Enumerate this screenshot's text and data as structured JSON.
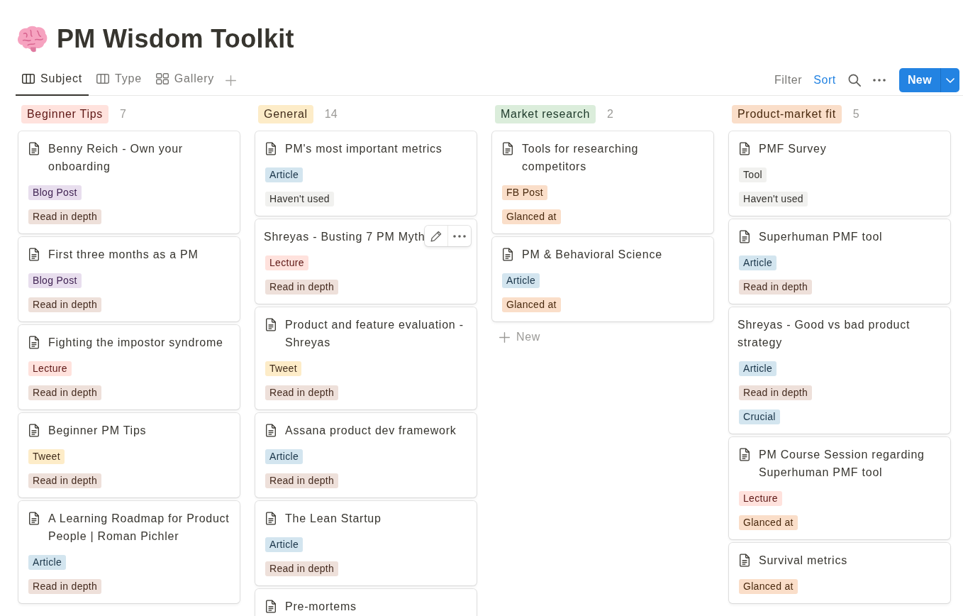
{
  "page": {
    "title": "PM Wisdom Toolkit"
  },
  "views": [
    {
      "label": "Subject",
      "kind": "board",
      "selected": true
    },
    {
      "label": "Type",
      "kind": "board",
      "selected": false
    },
    {
      "label": "Gallery",
      "kind": "gallery",
      "selected": false
    }
  ],
  "toolbar": {
    "actions": [
      {
        "label": "Filter",
        "active": false
      },
      {
        "label": "Sort",
        "active": true
      }
    ],
    "new_button": "New"
  },
  "columns": [
    {
      "title": "Beginner Tips",
      "color": "#ffe2dd",
      "count": "7",
      "cards": [
        {
          "title": "Benny Reich - Own your onboarding",
          "page_icon": true,
          "hovered": false,
          "tags": [
            {
              "label": "Blog Post",
              "color": "#e8deee"
            },
            {
              "label": "Read in depth",
              "color": "#eee0da"
            }
          ]
        },
        {
          "title": "First three months as a PM",
          "page_icon": true,
          "hovered": false,
          "tags": [
            {
              "label": "Blog Post",
              "color": "#e8deee"
            },
            {
              "label": "Read in depth",
              "color": "#eee0da"
            }
          ]
        },
        {
          "title": "Fighting the impostor syndrome",
          "page_icon": true,
          "hovered": false,
          "tags": [
            {
              "label": "Lecture",
              "color": "#ffe2dd"
            },
            {
              "label": "Read in depth",
              "color": "#eee0da"
            }
          ]
        },
        {
          "title": "Beginner PM Tips",
          "page_icon": true,
          "hovered": false,
          "tags": [
            {
              "label": "Tweet",
              "color": "#fdecc8"
            },
            {
              "label": "Read in depth",
              "color": "#eee0da"
            }
          ]
        },
        {
          "title": "A Learning Roadmap for Product People | Roman Pichler",
          "page_icon": true,
          "hovered": false,
          "tags": [
            {
              "label": "Article",
              "color": "#d3e5ef"
            },
            {
              "label": "Read in depth",
              "color": "#eee0da"
            }
          ]
        }
      ]
    },
    {
      "title": "General",
      "color": "#fdecc8",
      "count": "14",
      "cards": [
        {
          "title": "PM's most important metrics",
          "page_icon": true,
          "hovered": false,
          "tags": [
            {
              "label": "Article",
              "color": "#d3e5ef"
            },
            {
              "label": "Haven't used",
              "color": "#f1f1ef"
            }
          ]
        },
        {
          "title": "Shreyas - Busting 7 PM Myth",
          "page_icon": false,
          "hovered": true,
          "tags": [
            {
              "label": "Lecture",
              "color": "#ffe2dd"
            },
            {
              "label": "Read in depth",
              "color": "#eee0da"
            }
          ]
        },
        {
          "title": "Product and feature evaluation - Shreyas",
          "page_icon": true,
          "hovered": false,
          "tags": [
            {
              "label": "Tweet",
              "color": "#fdecc8"
            },
            {
              "label": "Read in depth",
              "color": "#eee0da"
            }
          ]
        },
        {
          "title": "Assana product dev framework",
          "page_icon": true,
          "hovered": false,
          "tags": [
            {
              "label": "Article",
              "color": "#d3e5ef"
            },
            {
              "label": "Read in depth",
              "color": "#eee0da"
            }
          ]
        },
        {
          "title": "The Lean Startup",
          "page_icon": true,
          "hovered": false,
          "tags": [
            {
              "label": "Article",
              "color": "#d3e5ef"
            },
            {
              "label": "Read in depth",
              "color": "#eee0da"
            }
          ]
        },
        {
          "title": "Pre-mortems",
          "page_icon": true,
          "hovered": false
        }
      ]
    },
    {
      "title": "Market research",
      "color": "#dbeddb",
      "count": "2",
      "add_label": "New",
      "cards": [
        {
          "title": "Tools for researching competitors",
          "page_icon": true,
          "hovered": false,
          "tags": [
            {
              "label": "FB Post",
              "color": "#fadec9"
            },
            {
              "label": "Glanced at",
              "color": "#fadec9"
            }
          ]
        },
        {
          "title": "PM & Behavioral Science",
          "page_icon": true,
          "hovered": false,
          "tags": [
            {
              "label": "Article",
              "color": "#d3e5ef"
            },
            {
              "label": "Glanced at",
              "color": "#fadec9"
            }
          ]
        }
      ]
    },
    {
      "title": "Product-market fit",
      "color": "#fadec9",
      "count": "5",
      "cards": [
        {
          "title": "PMF Survey",
          "page_icon": true,
          "hovered": false,
          "tags": [
            {
              "label": "Tool",
              "color": "#f1f1ef"
            },
            {
              "label": "Haven't used",
              "color": "#f1f1ef"
            }
          ]
        },
        {
          "title": "Superhuman PMF tool",
          "page_icon": true,
          "hovered": false,
          "tags": [
            {
              "label": "Article",
              "color": "#d3e5ef"
            },
            {
              "label": "Read in depth",
              "color": "#eee0da"
            }
          ]
        },
        {
          "title": "Shreyas - Good vs bad product strategy",
          "page_icon": false,
          "hovered": false,
          "tags": [
            {
              "label": "Article",
              "color": "#d3e5ef"
            },
            {
              "label": "Read in depth",
              "color": "#eee0da"
            },
            {
              "label": "Crucial",
              "color": "#d3e5ef"
            }
          ]
        },
        {
          "title": "PM Course Session regarding Superhuman PMF tool",
          "page_icon": true,
          "hovered": false,
          "tags": [
            {
              "label": "Lecture",
              "color": "#ffe2dd"
            },
            {
              "label": "Glanced at",
              "color": "#fadec9"
            }
          ]
        },
        {
          "title": "Survival metrics",
          "page_icon": true,
          "hovered": false,
          "tags": [
            {
              "label": "Glanced at",
              "color": "#fadec9"
            }
          ]
        }
      ]
    }
  ]
}
